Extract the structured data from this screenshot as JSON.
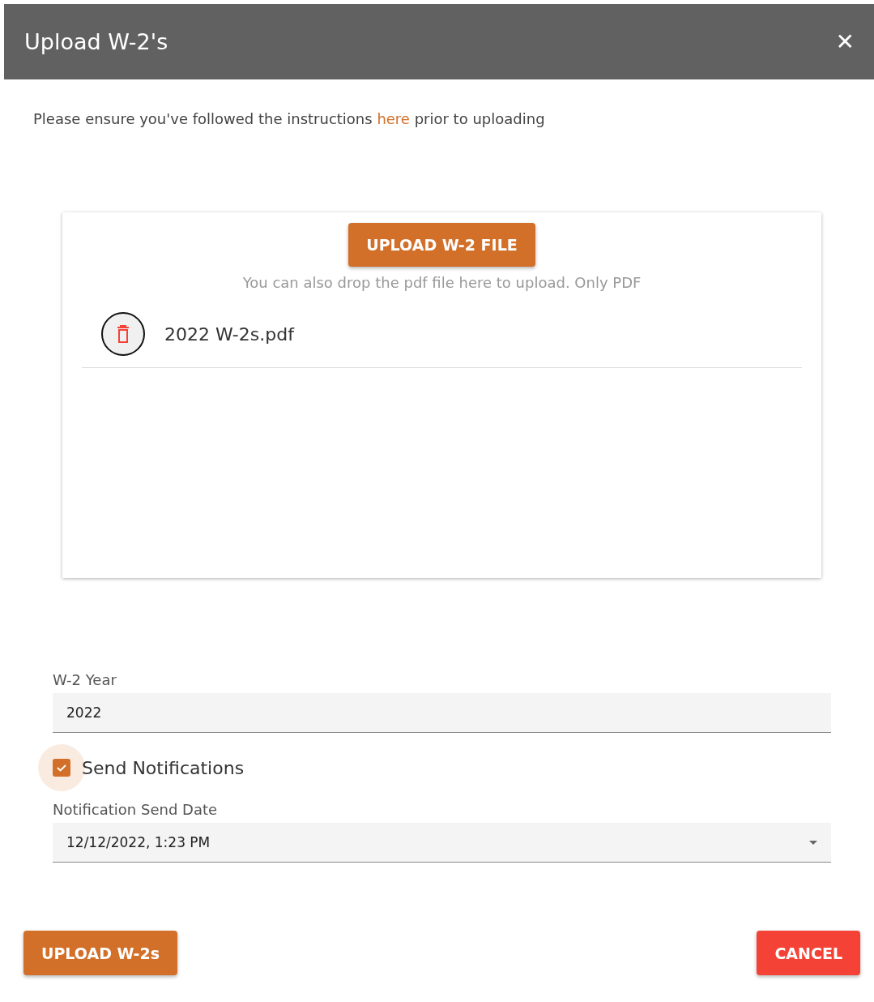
{
  "dialog": {
    "title": "Upload W-2's",
    "close_label": "✕"
  },
  "intro": {
    "before": "Please ensure you've followed the instructions ",
    "link": "here",
    "after": " prior to uploading"
  },
  "dropzone": {
    "button": "UPLOAD W-2 FILE",
    "hint": "You can also drop the pdf file here to upload. Only PDF",
    "files": [
      {
        "name": "2022 W-2s.pdf"
      }
    ]
  },
  "year_field": {
    "label": "W-2 Year",
    "value": "2022"
  },
  "notifications": {
    "label": "Send Notifications",
    "checked": true
  },
  "date_field": {
    "label": "Notification Send Date",
    "value": "12/12/2022, 1:23 PM"
  },
  "actions": [
    {
      "label": "UPLOAD W-2s",
      "kind": "primary"
    },
    {
      "label": "CANCEL",
      "kind": "danger"
    }
  ]
}
